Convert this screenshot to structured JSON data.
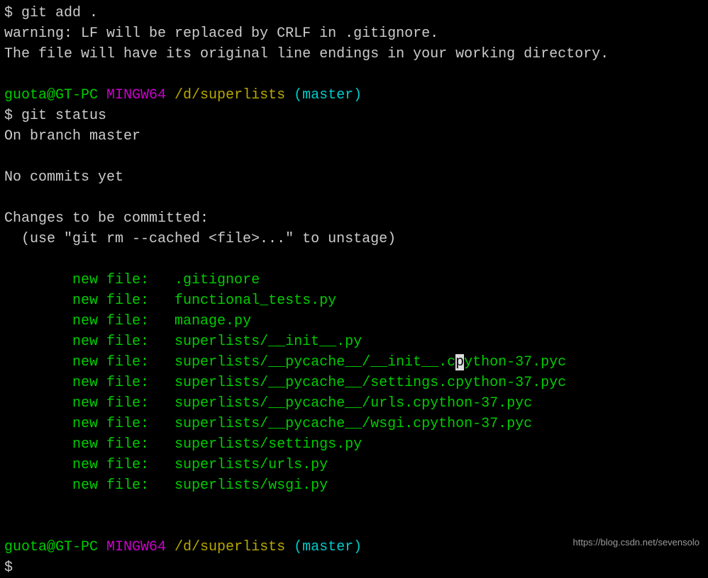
{
  "lines": {
    "cmd1_prompt": "$ ",
    "cmd1": "git add .",
    "warn1": "warning: LF will be replaced by CRLF in .gitignore.",
    "warn2": "The file will have its original line endings in your working directory.",
    "p1_user": "guota@GT-PC",
    "p1_mingw": " MINGW64",
    "p1_path": " /d/superlists",
    "p1_branch": " (master)",
    "cmd2_prompt": "$ ",
    "cmd2": "git status",
    "onbranch": "On branch master",
    "nocommits": "No commits yet",
    "changes": "Changes to be committed:",
    "unstage": "  (use \"git rm --cached <file>...\" to unstage)",
    "nf_label": "        new file:   ",
    "files": [
      ".gitignore",
      "functional_tests.py",
      "manage.py",
      "superlists/__init__.py",
      "superlists/__pycache__/__init__.cpython-37.pyc",
      "superlists/__pycache__/settings.cpython-37.pyc",
      "superlists/__pycache__/urls.cpython-37.pyc",
      "superlists/__pycache__/wsgi.cpython-37.pyc",
      "superlists/settings.py",
      "superlists/urls.py",
      "superlists/wsgi.py"
    ],
    "file4_pre": "superlists/__pycache__/__init__.c",
    "file4_cursor": "p",
    "file4_post": "ython-37.pyc",
    "p2_user": "guota@GT-PC",
    "p2_mingw": " MINGW64",
    "p2_path": " /d/superlists",
    "p2_branch": " (master)",
    "cmd3_prompt": "$"
  },
  "watermark": "https://blog.csdn.net/sevensolo"
}
